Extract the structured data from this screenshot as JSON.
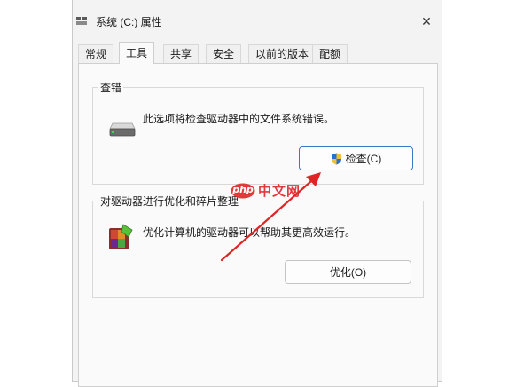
{
  "window": {
    "title": "系统 (C:) 属性",
    "close_glyph": "✕"
  },
  "tabs": [
    {
      "label": "常规",
      "active": false
    },
    {
      "label": "工具",
      "active": true
    },
    {
      "label": "共享",
      "active": false
    },
    {
      "label": "安全",
      "active": false
    },
    {
      "label": "以前的版本",
      "active": false
    },
    {
      "label": "配额",
      "active": false
    }
  ],
  "error_check": {
    "label": "查错",
    "icon": "drive-icon",
    "description": "此选项将检查驱动器中的文件系统错误。",
    "button_label": "检查(C)",
    "button_icon": "uac-shield-icon"
  },
  "optimize": {
    "label": "对驱动器进行优化和碎片整理",
    "icon": "defrag-icon",
    "description": "优化计算机的驱动器可以帮助其更高效运行。",
    "button_label": "优化(O)"
  },
  "watermark": {
    "logo_text": "php",
    "text": "中文网"
  },
  "colors": {
    "accent_border": "#3a78c4",
    "annotation_arrow": "#e02424",
    "dialog_bg": "#f3f3f3"
  }
}
